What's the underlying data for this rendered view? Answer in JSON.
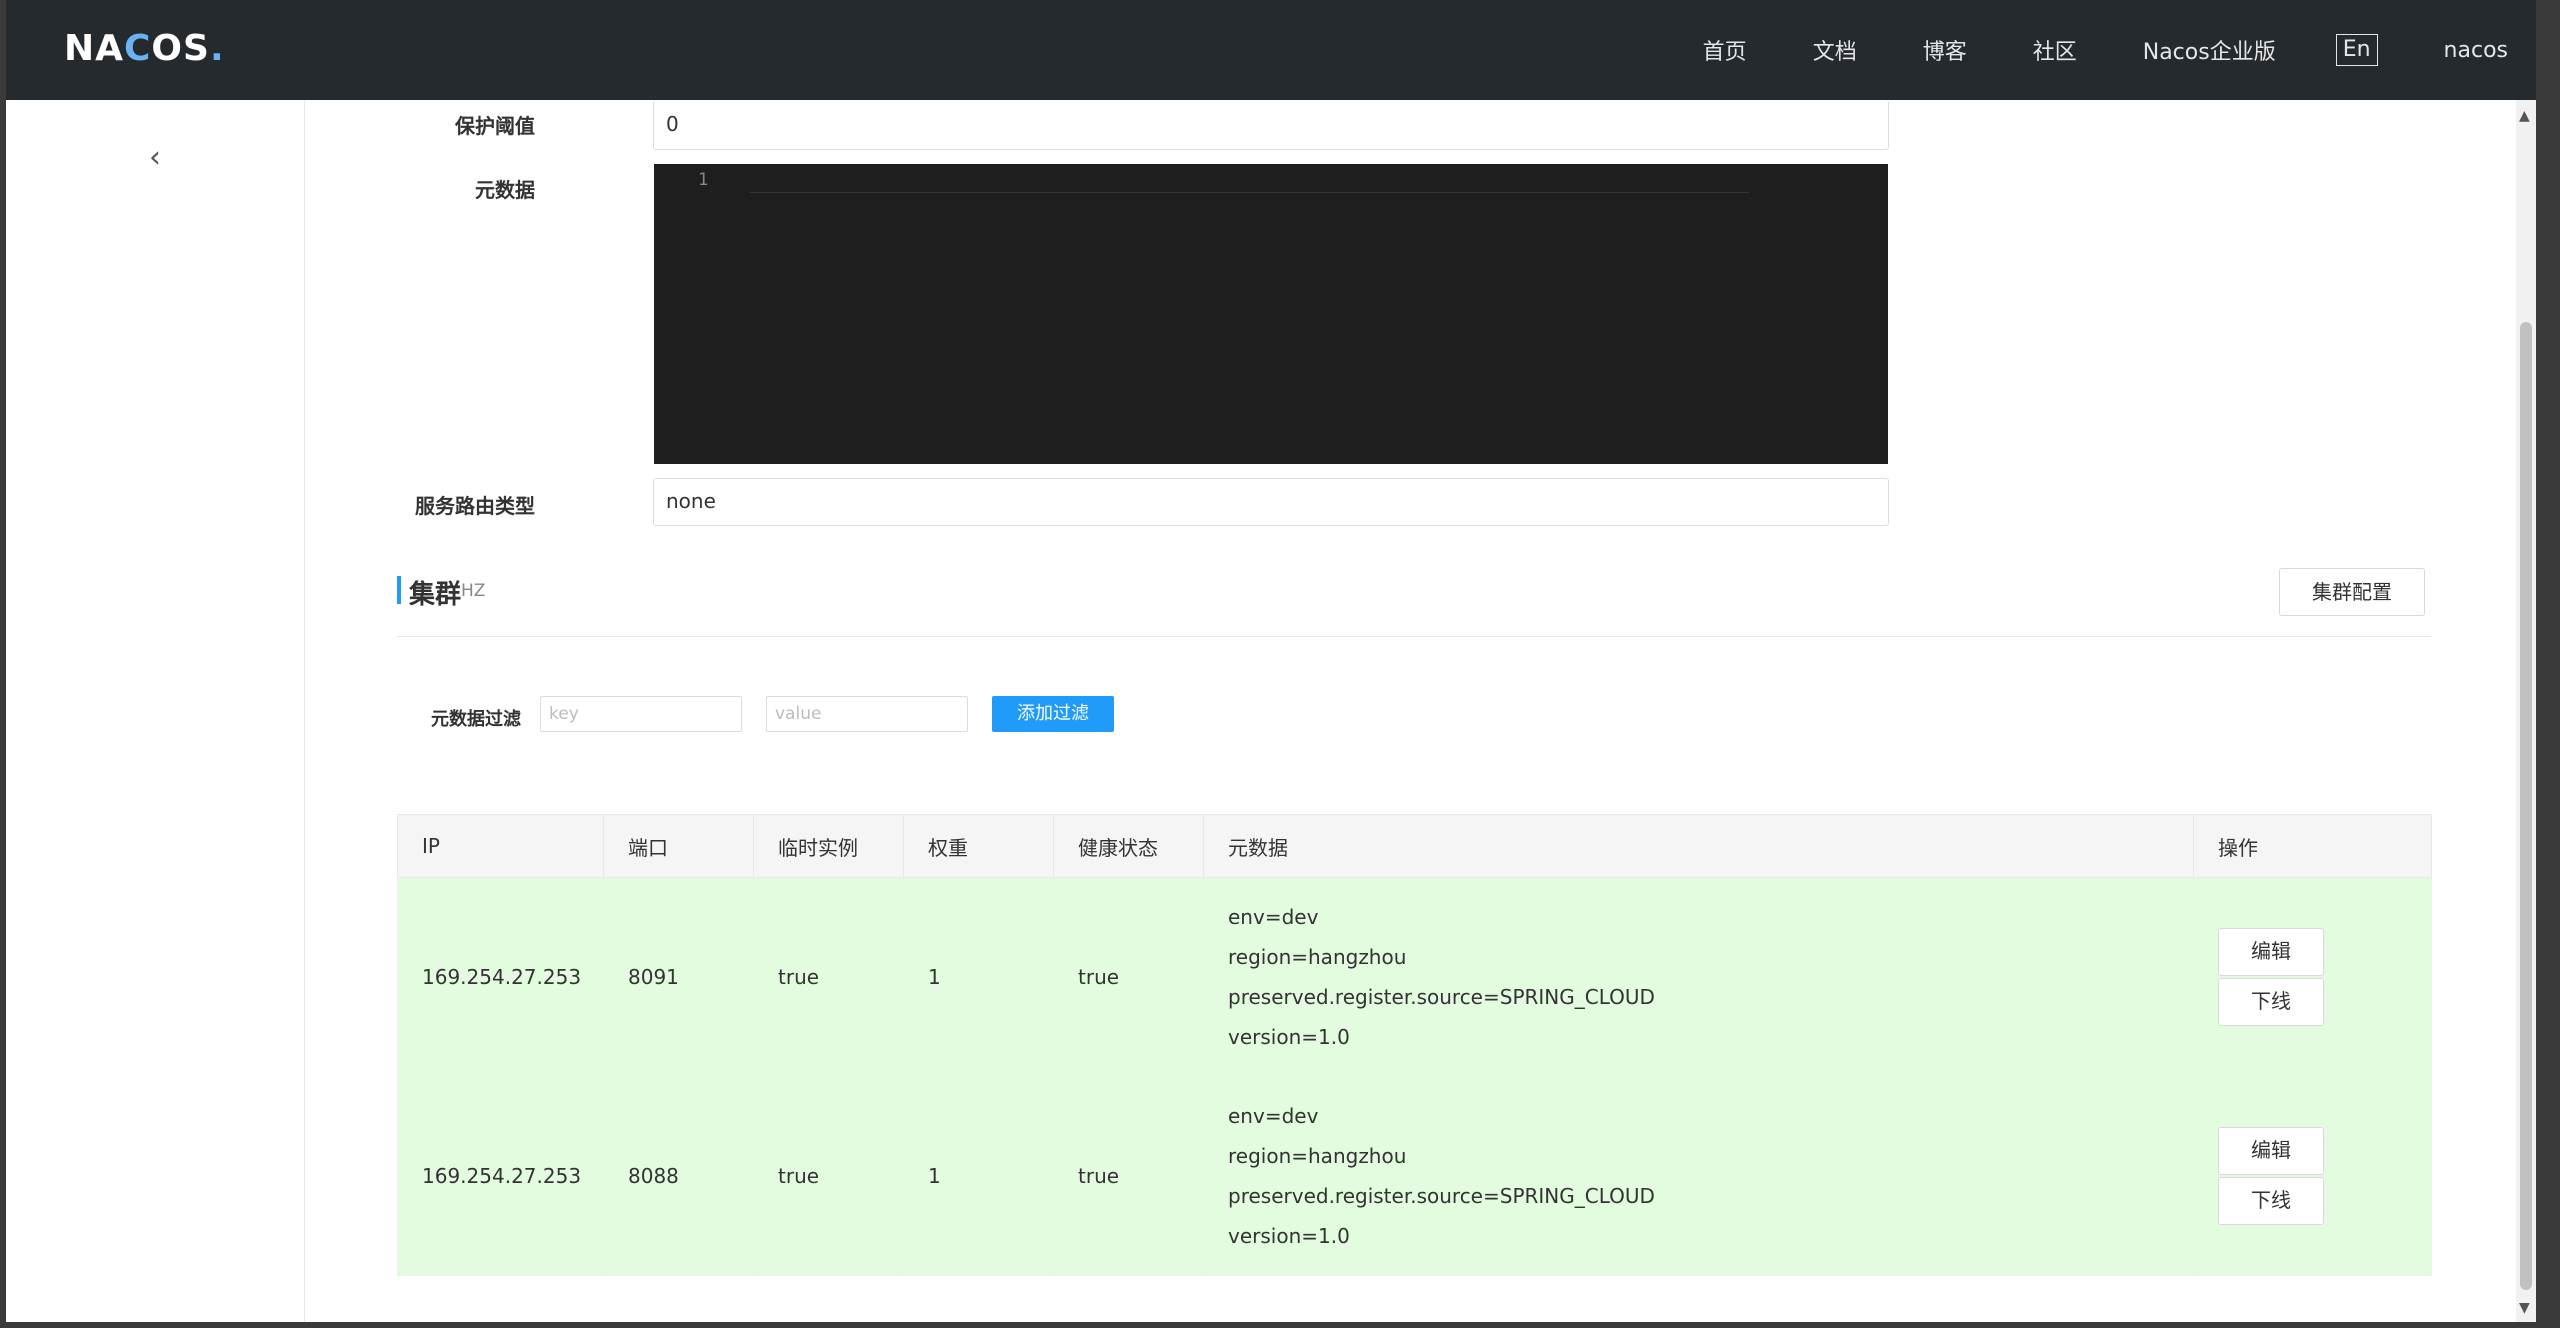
{
  "topbar": {
    "logo_text": "NACOS.",
    "nav": [
      "首页",
      "文档",
      "博客",
      "社区",
      "Nacos企业版"
    ],
    "lang": "En",
    "user": "nacos"
  },
  "sidebar": {
    "collapse_icon": "chevron-left-icon"
  },
  "form": {
    "protect_threshold_label": "保护阈值",
    "protect_threshold_value": "0",
    "metadata_label": "元数据",
    "editor_line_number": "1",
    "route_type_label": "服务路由类型",
    "route_type_value": "none"
  },
  "cluster": {
    "title": "集群",
    "name": "HZ",
    "config_button": "集群配置"
  },
  "filter": {
    "label": "元数据过滤",
    "key_placeholder": "key",
    "value_placeholder": "value",
    "add_button": "添加过滤"
  },
  "table": {
    "headers": [
      "IP",
      "端口",
      "临时实例",
      "权重",
      "健康状态",
      "元数据",
      "操作"
    ],
    "rows": [
      {
        "ip": "169.254.27.253",
        "port": "8091",
        "ephemeral": "true",
        "weight": "1",
        "healthy": "true",
        "metadata": [
          "env=dev",
          "region=hangzhou",
          "preserved.register.source=SPRING_CLOUD",
          "version=1.0"
        ],
        "edit": "编辑",
        "offline": "下线"
      },
      {
        "ip": "169.254.27.253",
        "port": "8088",
        "ephemeral": "true",
        "weight": "1",
        "healthy": "true",
        "metadata": [
          "env=dev",
          "region=hangzhou",
          "preserved.register.source=SPRING_CLOUD",
          "version=1.0"
        ],
        "edit": "编辑",
        "offline": "下线"
      }
    ]
  },
  "colors": {
    "accent": "#209bfa",
    "topbar": "#252a2f",
    "row_bg": "#e3fce0"
  }
}
